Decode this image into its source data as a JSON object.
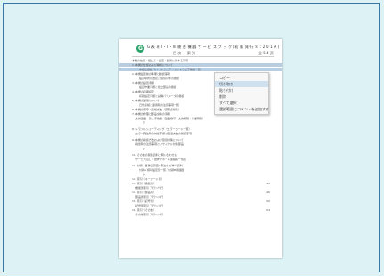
{
  "document": {
    "logo_letter": "G",
    "title": "G 表 現 I・II・III 総 合 機 器 サ ー ビ ス ブ ッ ク (初 版 発 行 年 : 2 0 1 9 )",
    "subtitle": "目 次 ・ 索 引",
    "pages": "全 5 4 頁",
    "lines": [
      {
        "text": "本機の仕様・組込み・設定・運用に関する事項"
      },
      {
        "text": "1. 本機の仕様および構成について",
        "selected": true
      },
      {
        "text": "本機仕様書（ハードウェア・ソフトウェア構成一覧）",
        "indent": 2,
        "selected": true
      },
      {
        "text": "2. 本機設置前の準備と確認事項"
      },
      {
        "text": "設置場所の選定と環境条件の確認",
        "indent": 2
      },
      {
        "text": "3. 本機の設置手順"
      },
      {
        "text": "設置作業手順と組立部品の確認",
        "indent": 2
      },
      {
        "text": "4. 本機の初期設定"
      },
      {
        "text": "初期設定手順と各種パラメータの確認",
        "indent": 2
      },
      {
        "text": "5. 本機の運用について"
      },
      {
        "text": "日常点検と運用時の注意事項一覧",
        "indent": 2
      },
      {
        "text": "6. 本機の保守・点検方法（定期点検表）"
      },
      {
        "text": "7. 本機の修理と部品交換の手順"
      },
      {
        "text": "交換部品一覧と手順書（部品番号・交換間隔・作業時間）",
        "indent": 1
      },
      {
        "text": "ア",
        "indent": 3
      },
      {
        "text": "8. トラブルシューティング（エラーコード一覧）",
        "gap": true
      },
      {
        "text": "エラー発生時の対処手順と復旧方法の確認事項",
        "indent": 1
      },
      {
        "text": "9. 本機の廃棄方法および環境対策について",
        "gap": true
      },
      {
        "text": "廃棄時の注意事項とリサイクル対象部品",
        "indent": 1
      },
      {
        "text": "イ",
        "indent": 3
      },
      {
        "text": "10. その他の関連資料と問い合わせ先",
        "gap": true
      },
      {
        "text": "サービス窓口・技術サポート連絡先一覧表",
        "indent": 1
      },
      {
        "text": "11. 付録：各種設定値一覧および参考資料",
        "gap": true
      },
      {
        "text": "付録A 標準設定値一覧／付録B 用語集",
        "indent": 2
      },
      {
        "text": "ウ",
        "indent": 3
      },
      {
        "text": "12. 索引（キーワード別）"
      },
      {
        "text": "13. 索引（機能別）",
        "page": "42"
      },
      {
        "text": "機能別索引 ア行〜サ行",
        "indent": 1
      },
      {
        "text": "14. 索引（部品別）",
        "page": "46"
      },
      {
        "text": "部品別索引 ア行〜カ行",
        "indent": 1
      },
      {
        "text": "15. 索引（記号別）",
        "page": "50"
      },
      {
        "text": "記号別索引 ア行〜タ行",
        "indent": 1
      },
      {
        "text": "16. 索引（その他）",
        "page": "54"
      },
      {
        "text": "その他索引 ア行〜ナ行",
        "indent": 1
      }
    ]
  },
  "context_menu": {
    "items": [
      {
        "label": "コピー",
        "highlighted": false
      },
      {
        "label": "切り取り",
        "highlighted": true
      },
      {
        "label": "貼り付け",
        "highlighted": false
      },
      {
        "label": "削除",
        "highlighted": false
      },
      {
        "label": "すべて選択",
        "highlighted": false
      },
      {
        "label": "選択範囲にコメントを追加する",
        "highlighted": false
      }
    ]
  }
}
